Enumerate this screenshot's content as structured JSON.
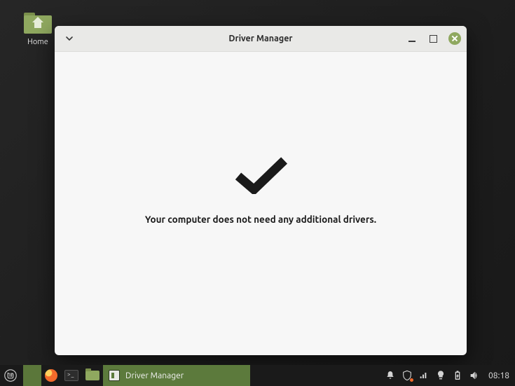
{
  "desktop": {
    "home_label": "Home"
  },
  "window": {
    "title": "Driver Manager",
    "message": "Your computer does not need any additional drivers."
  },
  "taskbar": {
    "active_task_label": "Driver Manager",
    "clock": "08:18"
  }
}
